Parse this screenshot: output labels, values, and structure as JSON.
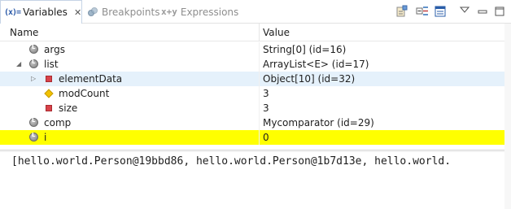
{
  "tabs": [
    {
      "label": "Variables",
      "icon": "variables-icon",
      "active": true
    },
    {
      "label": "Breakpoints",
      "icon": "breakpoints-icon",
      "active": false
    },
    {
      "label": "Expressions",
      "icon": "expressions-icon",
      "active": false
    }
  ],
  "tab_icon_text": "(x)=",
  "toolbar": [
    "show-type-names-icon",
    "collapse-all-icon",
    "layout-icon",
    "view-menu-icon",
    "minimize-icon",
    "maximize-icon"
  ],
  "columns": {
    "name": "Name",
    "value": "Value"
  },
  "rows": [
    {
      "name": "args",
      "value": "String[0]  (id=16)",
      "icon": "local-variable-icon",
      "indent": 0,
      "expander": "none",
      "highlight": "none"
    },
    {
      "name": "list",
      "value": "ArrayList<E>  (id=17)",
      "icon": "local-variable-icon",
      "indent": 0,
      "expander": "expanded",
      "highlight": "none"
    },
    {
      "name": "elementData",
      "value": "Object[10]  (id=32)",
      "icon": "private-field-icon",
      "indent": 1,
      "expander": "collapsed",
      "highlight": "blue"
    },
    {
      "name": "modCount",
      "value": "3",
      "icon": "protected-field-icon",
      "indent": 1,
      "expander": "none",
      "highlight": "none"
    },
    {
      "name": "size",
      "value": "3",
      "icon": "private-field-icon",
      "indent": 1,
      "expander": "none",
      "highlight": "none"
    },
    {
      "name": "comp",
      "value": "Mycomparator  (id=29)",
      "icon": "local-variable-icon",
      "indent": 0,
      "expander": "none",
      "highlight": "none"
    },
    {
      "name": "i",
      "value": "0",
      "icon": "local-variable-icon",
      "indent": 0,
      "expander": "none",
      "highlight": "yellow"
    }
  ],
  "detail_text": "[hello.world.Person@19bbd86, hello.world.Person@1b7d13e, hello.world.",
  "colors": {
    "row_highlight_yellow": "#ffff00",
    "row_highlight_blue": "#e5f1fb"
  }
}
